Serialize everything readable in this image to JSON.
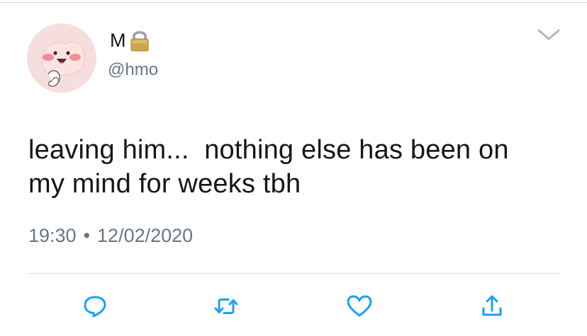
{
  "account": {
    "display_name": "M",
    "handle": "@hmo",
    "avatar_icon": "peach-character-avatar",
    "protected_icon": "lock-icon"
  },
  "tweet": {
    "lines": [
      "leaving him...  nothing else has been on",
      "my mind for weeks tbh"
    ],
    "time": "19:30",
    "separator": "•",
    "date": "12/02/2020"
  },
  "actions": [
    {
      "icon": "reply-icon"
    },
    {
      "icon": "retweet-icon"
    },
    {
      "icon": "like-icon"
    },
    {
      "icon": "share-icon"
    }
  ],
  "menu_icon": "chevron-down-icon",
  "colors": {
    "text": "#14171a",
    "secondary": "#657786",
    "icon": "#1da1f2",
    "avatar_bg": "#f6dede"
  }
}
